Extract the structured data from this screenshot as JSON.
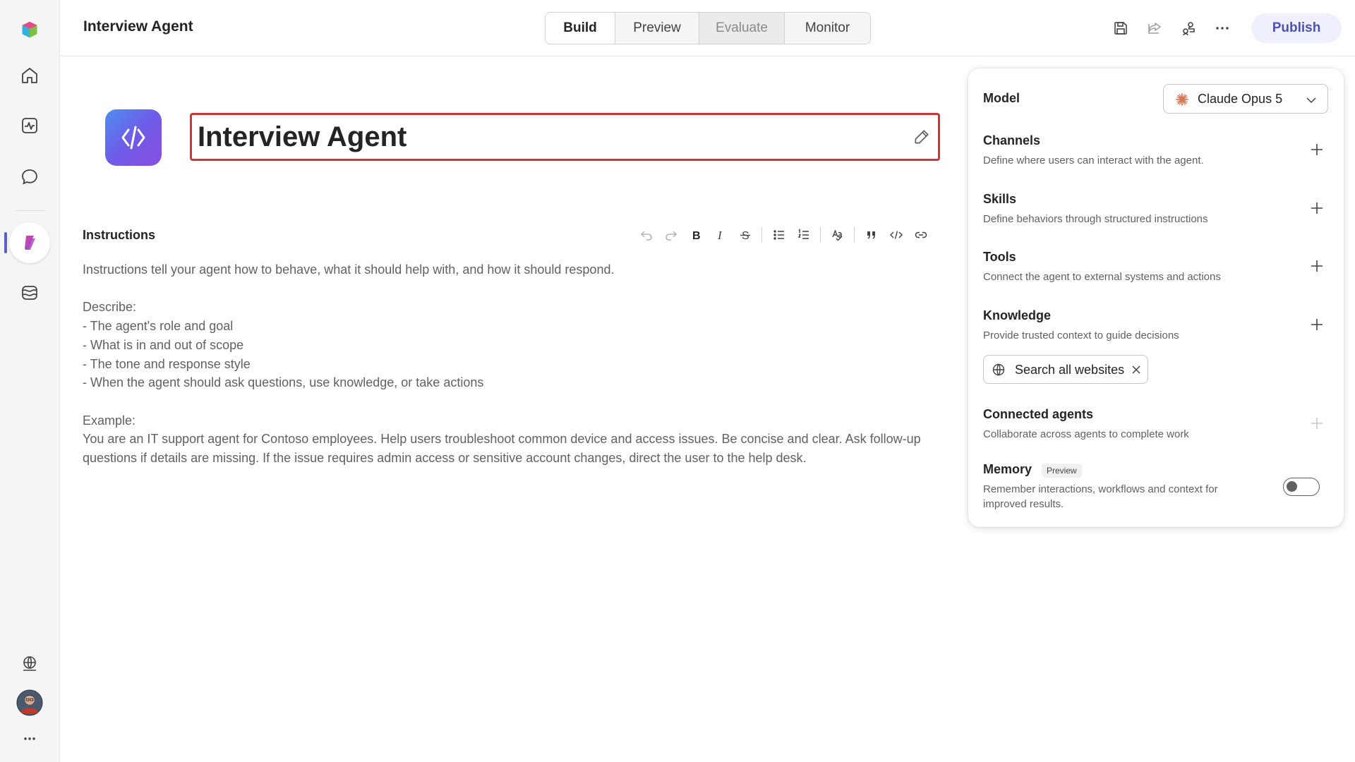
{
  "header": {
    "title": "Interview Agent",
    "tabs": [
      "Build",
      "Preview",
      "Evaluate",
      "Monitor"
    ],
    "publish_label": "Publish"
  },
  "agent": {
    "name": "Interview Agent"
  },
  "instructions": {
    "label": "Instructions",
    "paragraphs": [
      "Instructions tell your agent how to behave, what it should help with, and how it should respond.",
      "Describe:\n- The agent's role and goal\n- What is in and out of scope\n- The tone and response style\n- When the agent should ask questions, use knowledge, or take actions",
      "Example:\nYou are an IT support agent for Contoso employees. Help users troubleshoot common device and access issues. Be concise and clear. Ask follow-up questions if details are missing. If the issue requires admin access or sensitive account changes, direct the user to the help desk."
    ]
  },
  "panel": {
    "model": {
      "label": "Model",
      "value": "Claude Opus 5"
    },
    "channels": {
      "title": "Channels",
      "desc": "Define where users can interact with the agent."
    },
    "skills": {
      "title": "Skills",
      "desc": "Define behaviors through structured instructions"
    },
    "tools": {
      "title": "Tools",
      "desc": "Connect the agent to external systems and actions"
    },
    "knowledge": {
      "title": "Knowledge",
      "desc": "Provide trusted context to guide decisions",
      "chip": "Search all websites"
    },
    "connected_agents": {
      "title": "Connected agents",
      "desc": "Collaborate across agents to complete work"
    },
    "memory": {
      "title": "Memory",
      "badge": "Preview",
      "desc": "Remember interactions, workflows and context for improved results.",
      "enabled": false
    }
  },
  "colors": {
    "accent": "#5b5fc7",
    "publish_bg": "#eef0fb",
    "highlight_border": "#d13438"
  }
}
